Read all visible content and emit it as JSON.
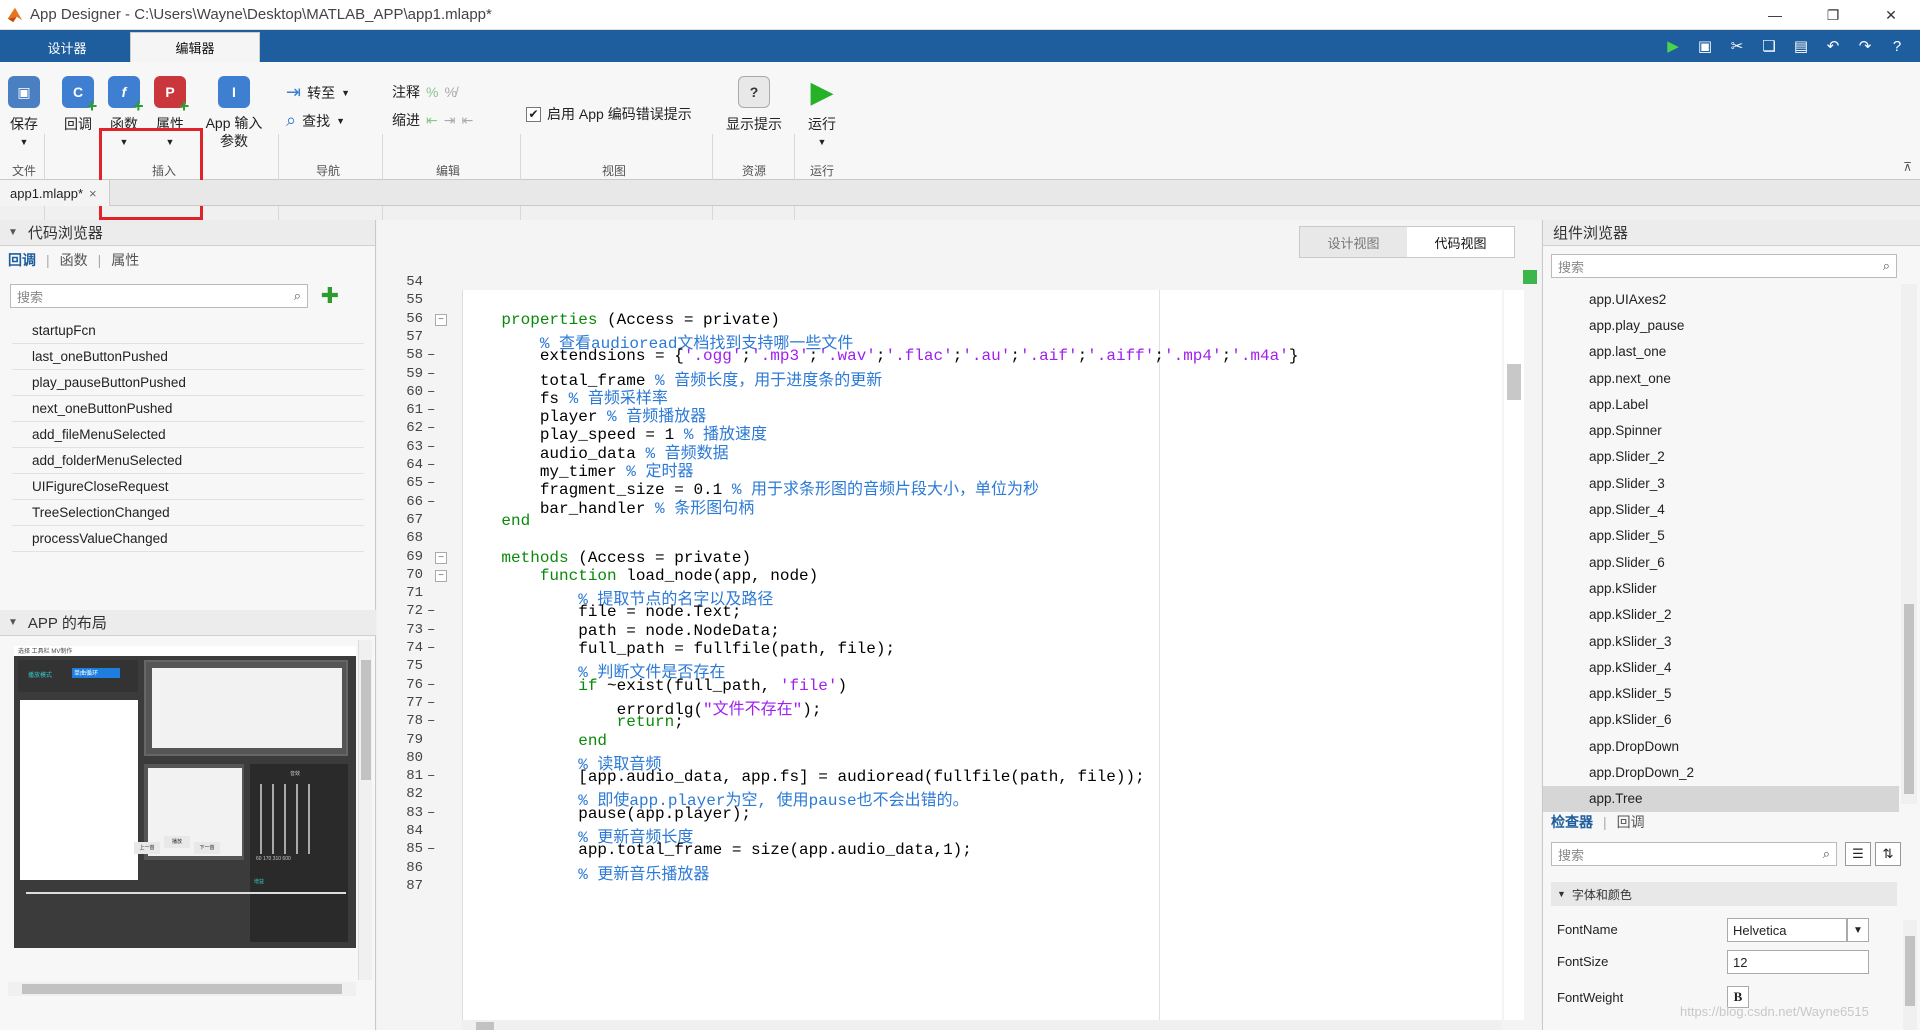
{
  "window": {
    "title": "App Designer - C:\\Users\\Wayne\\Desktop\\MATLAB_APP\\app1.mlapp*"
  },
  "tabs": [
    {
      "label": "设计器"
    },
    {
      "label": "编辑器"
    }
  ],
  "ribbon": {
    "save": "保存",
    "callback": "回调",
    "function": "函数",
    "property": "属性",
    "app_input": "App 输入参数",
    "goto": "转至",
    "find": "查找",
    "comment": "注释",
    "indent": "缩进",
    "enable_hint": "启用 App 编码错误提示",
    "show_tips": "显示提示",
    "run": "运行",
    "groups": {
      "file": "文件",
      "insert": "插入",
      "navigate": "导航",
      "edit": "编辑",
      "view": "视图",
      "resources": "资源",
      "run": "运行"
    }
  },
  "doc_tab": {
    "label": "app1.mlapp*",
    "close": "×"
  },
  "code_browser": {
    "title": "代码浏览器",
    "tabs": {
      "callbacks": "回调",
      "functions": "函数",
      "properties": "属性"
    },
    "search_placeholder": "搜索",
    "items": [
      "startupFcn",
      "last_oneButtonPushed",
      "play_pauseButtonPushed",
      "next_oneButtonPushed",
      "add_fileMenuSelected",
      "add_folderMenuSelected",
      "UIFigureCloseRequest",
      "TreeSelectionChanged",
      "processValueChanged"
    ]
  },
  "app_layout": {
    "title": "APP 的布局",
    "preview": {
      "menu": "选择  工具栏  MV制作",
      "mode_label": "播放模式",
      "mode_value": "单曲循环",
      "btn_prev": "上一首",
      "btn_play": "播放",
      "btn_next": "下一首",
      "gain_label": "增益",
      "eq_label": "音效",
      "eq_freqs": "60 170 310 600"
    }
  },
  "editor": {
    "view_tabs": {
      "design": "设计视图",
      "code": "代码视图"
    },
    "lines": [
      {
        "n": "54",
        "dash": false,
        "fold": false,
        "html": ""
      },
      {
        "n": "55",
        "dash": false,
        "fold": false,
        "html": ""
      },
      {
        "n": "56",
        "dash": false,
        "fold": true,
        "html": "    <span class='k'>properties</span> (Access = private)"
      },
      {
        "n": "57",
        "dash": false,
        "fold": false,
        "html": "        <span class='c'>% 查看audioread文档找到支持哪一些文件</span>"
      },
      {
        "n": "58",
        "dash": true,
        "fold": false,
        "html": "        extendsions = {<span class='s'>'.ogg'</span>;<span class='s'>'.mp3'</span>;<span class='s'>'.wav'</span>;<span class='s'>'.flac'</span>;<span class='s'>'.au'</span>;<span class='s'>'.aif'</span>;<span class='s'>'.aiff'</span>;<span class='s'>'.mp4'</span>;<span class='s'>'.m4a'</span>}"
      },
      {
        "n": "59",
        "dash": true,
        "fold": false,
        "html": "        total_frame <span class='c'>% 音频长度，用于进度条的更新</span>"
      },
      {
        "n": "60",
        "dash": true,
        "fold": false,
        "html": "        fs <span class='c'>% 音频采样率</span>"
      },
      {
        "n": "61",
        "dash": true,
        "fold": false,
        "html": "        player <span class='c'>% 音频播放器</span>"
      },
      {
        "n": "62",
        "dash": true,
        "fold": false,
        "html": "        play_speed = 1 <span class='c'>% 播放速度</span>"
      },
      {
        "n": "63",
        "dash": true,
        "fold": false,
        "html": "        audio_data <span class='c'>% 音频数据</span>"
      },
      {
        "n": "64",
        "dash": true,
        "fold": false,
        "html": "        my_timer <span class='c'>% 定时器</span>"
      },
      {
        "n": "65",
        "dash": true,
        "fold": false,
        "html": "        fragment_size = 0.1 <span class='c'>% 用于求条形图的音频片段大小，单位为秒</span>"
      },
      {
        "n": "66",
        "dash": true,
        "fold": false,
        "html": "        bar_handler <span class='c'>% 条形图句柄</span>"
      },
      {
        "n": "67",
        "dash": false,
        "fold": false,
        "html": "    <span class='k'>end</span>"
      },
      {
        "n": "68",
        "dash": false,
        "fold": false,
        "html": ""
      },
      {
        "n": "69",
        "dash": false,
        "fold": true,
        "html": "    <span class='k'>methods</span> (Access = private)"
      },
      {
        "n": "70",
        "dash": false,
        "fold": true,
        "html": "        <span class='k'>function</span> load_node(app, node)"
      },
      {
        "n": "71",
        "dash": false,
        "fold": false,
        "html": "            <span class='c'>% 提取节点的名字以及路径</span>"
      },
      {
        "n": "72",
        "dash": true,
        "fold": false,
        "html": "            file = node.Text;"
      },
      {
        "n": "73",
        "dash": true,
        "fold": false,
        "html": "            path = node.NodeData;"
      },
      {
        "n": "74",
        "dash": true,
        "fold": false,
        "html": "            full_path = fullfile(path, file);"
      },
      {
        "n": "75",
        "dash": false,
        "fold": false,
        "html": "            <span class='c'>% 判断文件是否存在</span>"
      },
      {
        "n": "76",
        "dash": true,
        "fold": false,
        "html": "            <span class='k'>if</span> ~exist(full_path, <span class='s'>'file'</span>)"
      },
      {
        "n": "77",
        "dash": true,
        "fold": false,
        "html": "                errordlg(<span class='s'>\"文件不存在\"</span>);"
      },
      {
        "n": "78",
        "dash": true,
        "fold": false,
        "html": "                <span class='k'>return</span>;"
      },
      {
        "n": "79",
        "dash": false,
        "fold": false,
        "html": "            <span class='k'>end</span>"
      },
      {
        "n": "80",
        "dash": false,
        "fold": false,
        "html": "            <span class='c'>% 读取音频</span>"
      },
      {
        "n": "81",
        "dash": true,
        "fold": false,
        "html": "            [app.audio_data, app.fs] = audioread(fullfile(path, file));"
      },
      {
        "n": "82",
        "dash": false,
        "fold": false,
        "html": "            <span class='c'>% 即使app.player为空, 使用pause也不会出错的。</span>"
      },
      {
        "n": "83",
        "dash": true,
        "fold": false,
        "html": "            pause(app.player);"
      },
      {
        "n": "84",
        "dash": false,
        "fold": false,
        "html": "            <span class='c'>% 更新音频长度</span>"
      },
      {
        "n": "85",
        "dash": true,
        "fold": false,
        "html": "            app.total_frame = size(app.audio_data,1);"
      },
      {
        "n": "86",
        "dash": false,
        "fold": false,
        "html": "            <span class='c'>% 更新音乐播放器</span>"
      },
      {
        "n": "87",
        "dash": false,
        "fold": false,
        "html": ""
      }
    ]
  },
  "component_browser": {
    "title": "组件浏览器",
    "search_placeholder": "搜索",
    "items": [
      "app.UIAxes2",
      "app.play_pause",
      "app.last_one",
      "app.next_one",
      "app.Label",
      "app.Spinner",
      "app.Slider_2",
      "app.Slider_3",
      "app.Slider_4",
      "app.Slider_5",
      "app.Slider_6",
      "app.kSlider",
      "app.kSlider_2",
      "app.kSlider_3",
      "app.kSlider_4",
      "app.kSlider_5",
      "app.kSlider_6",
      "app.DropDown",
      "app.DropDown_2",
      "app.Tree"
    ],
    "selected": "app.Tree"
  },
  "inspector": {
    "tabs": {
      "inspector": "检查器",
      "callbacks": "回调"
    },
    "search_placeholder": "搜索",
    "section": "字体和颜色",
    "props": [
      {
        "name": "FontName",
        "value": "Helvetica"
      },
      {
        "name": "FontSize",
        "value": "12"
      },
      {
        "name": "FontWeight",
        "value": "B"
      }
    ]
  },
  "watermark": "https://blog.csdn.net/Wayne6515",
  "colors": {
    "tabstrip": "#1f5e9e",
    "keyword": "#0a8a0a",
    "comment": "#2c7ad6",
    "string": "#a020f0",
    "highlight": "#e0232a"
  },
  "icons": [
    "matlab-logo-icon",
    "save-icon",
    "callback-icon",
    "function-icon",
    "property-icon",
    "app-input-icon",
    "goto-icon",
    "find-icon",
    "comment-icon",
    "indent-icon",
    "checkbox-icon",
    "help-icon",
    "run-icon",
    "search-icon",
    "add-icon"
  ]
}
